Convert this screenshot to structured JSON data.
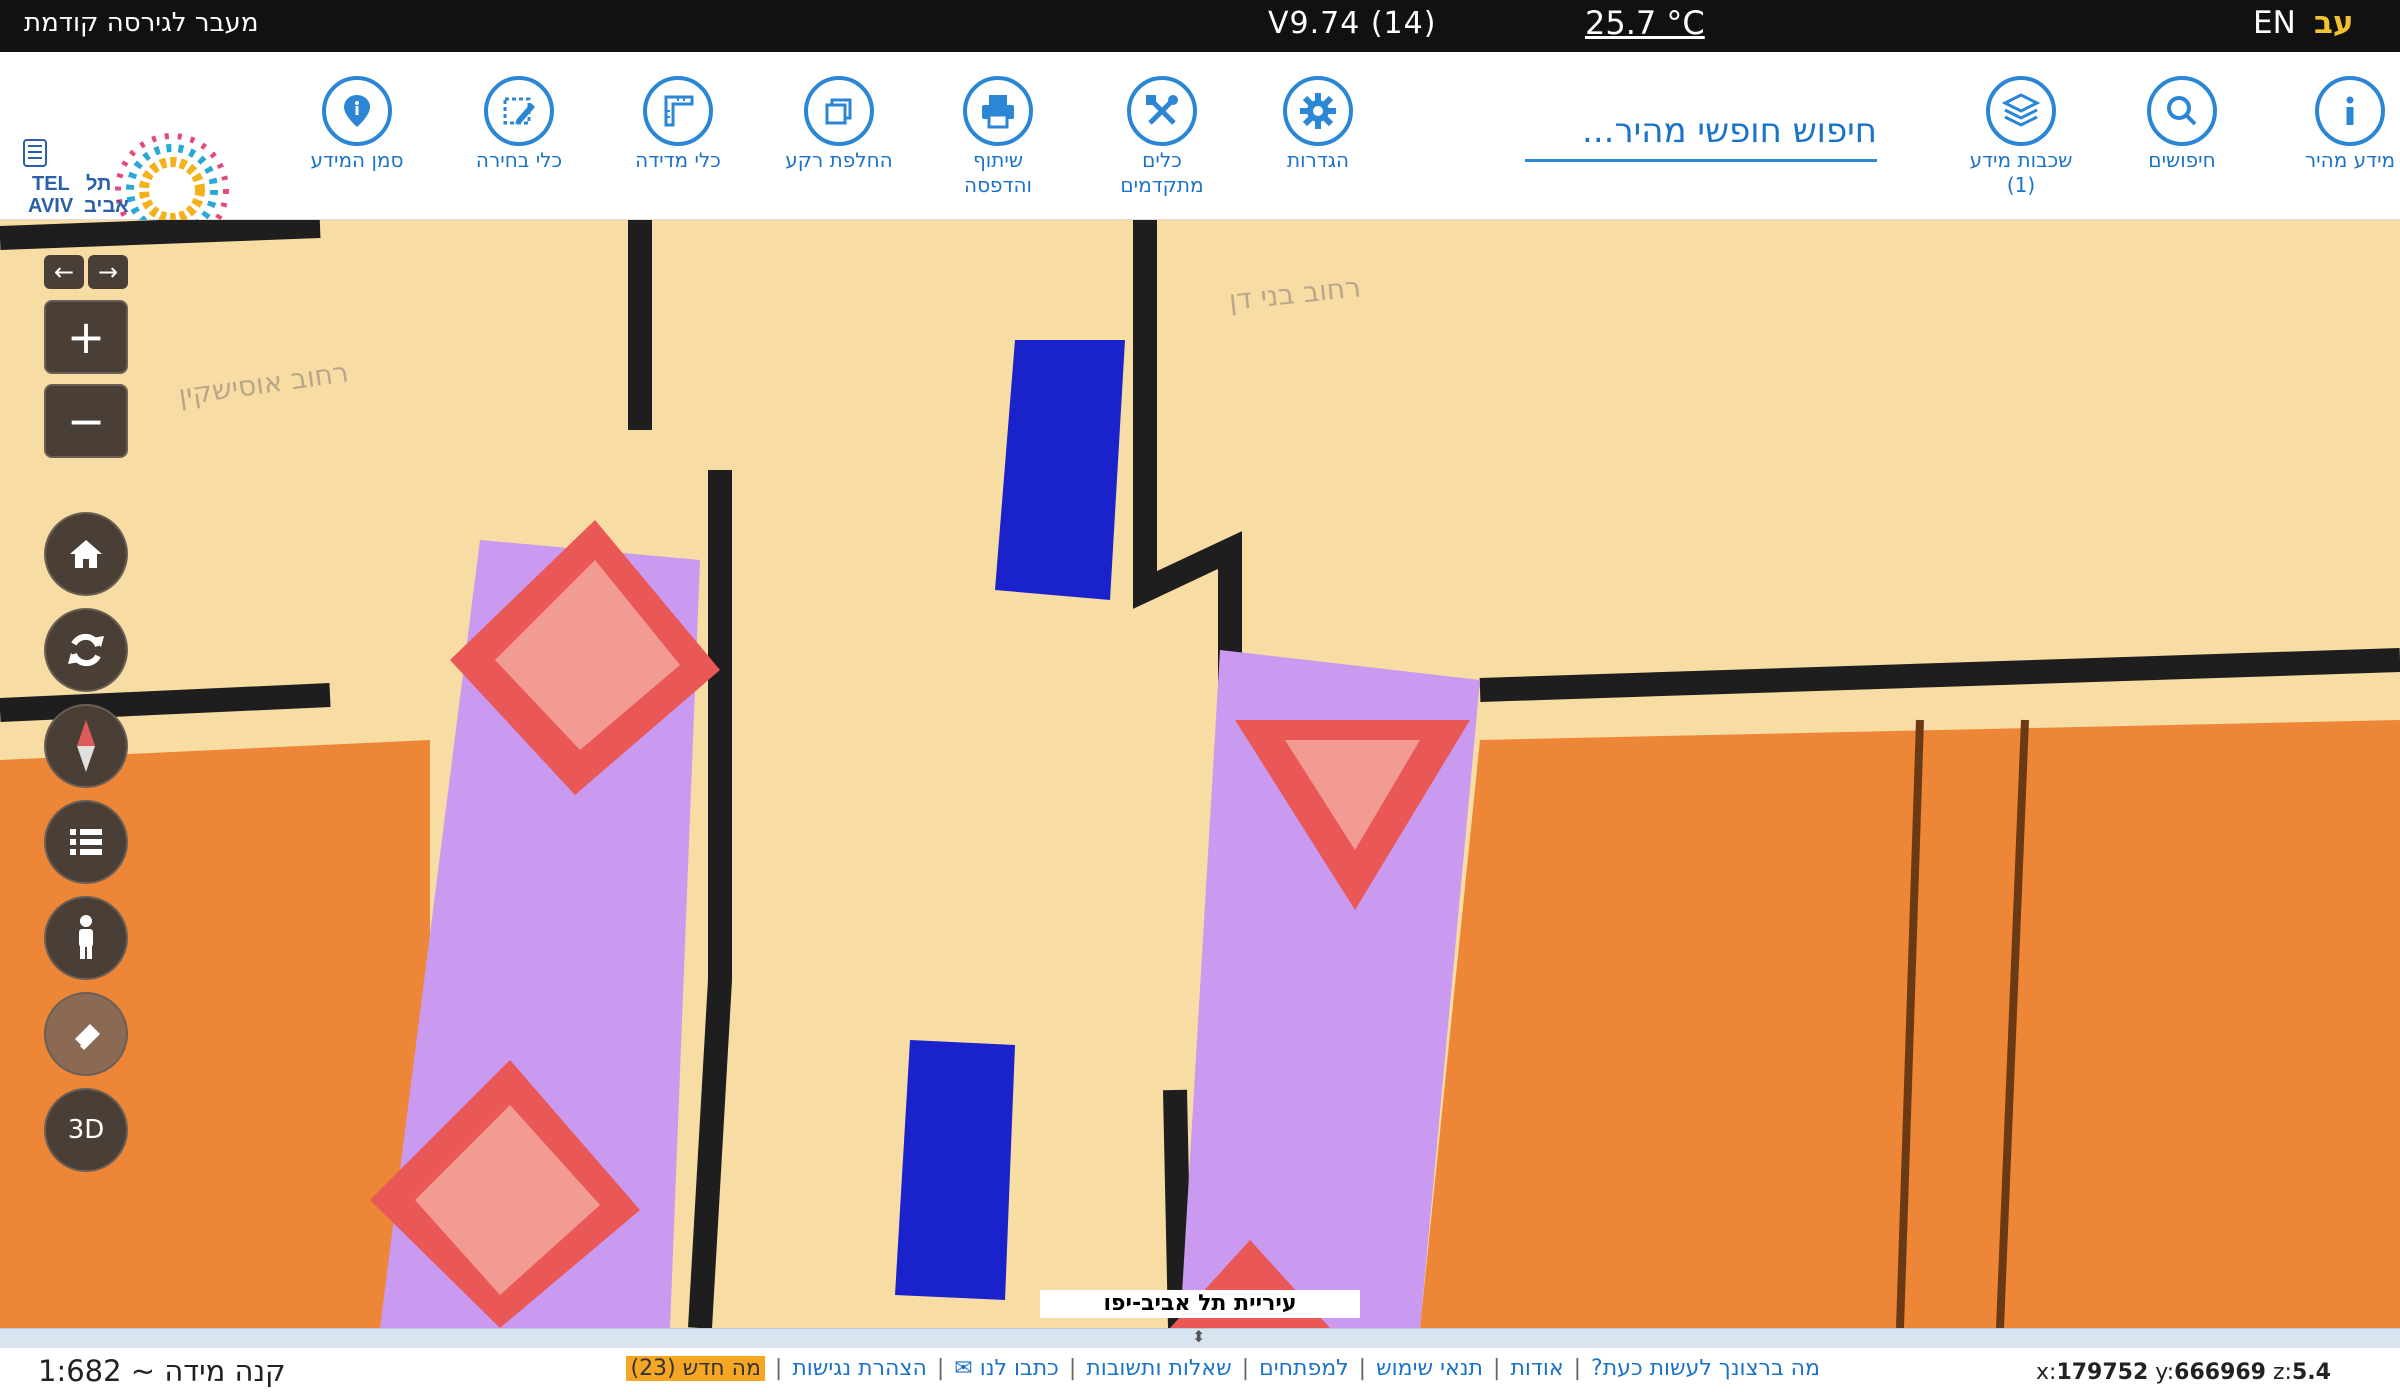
{
  "topbar": {
    "prev_version": "מעבר לגירסה קודמת",
    "version": "V9.74 (14)",
    "temperature": "25.7 °C",
    "lang_en": "EN",
    "lang_he": "עב"
  },
  "toolbar": {
    "tools": [
      {
        "label": "מידע מהיר",
        "label2": "",
        "icon": "info-icon"
      },
      {
        "label": "חיפושים",
        "label2": "",
        "icon": "search-icon"
      },
      {
        "label": "שכבות מידע",
        "label2": "(1)",
        "icon": "layers-icon"
      },
      {
        "label": "הגדרות",
        "label2": "",
        "icon": "gear-icon"
      },
      {
        "label": "כלים",
        "label2": "מתקדמים",
        "icon": "tools-icon"
      },
      {
        "label": "שיתוף",
        "label2": "והדפסה",
        "icon": "print-icon"
      },
      {
        "label": "החלפת רקע",
        "label2": "",
        "icon": "background-swap-icon"
      },
      {
        "label": "כלי מדידה",
        "label2": "",
        "icon": "ruler-icon"
      },
      {
        "label": "כלי בחירה",
        "label2": "",
        "icon": "select-edit-icon"
      },
      {
        "label": "סמן המידע",
        "label2": "",
        "icon": "map-pin-icon"
      }
    ],
    "search_placeholder": "חיפוש חופשי מהיר...",
    "logo_text": "TEL AVIV YAFO תל אביב יפו"
  },
  "map": {
    "controls": {
      "zoom_in": "+",
      "zoom_out": "−",
      "threed": "3D"
    },
    "labels": {
      "street1": "רחוב בני דן",
      "street2": "רחוב אוסישקין",
      "big_text": "בני דן"
    },
    "city_label": "עיריית תל אביב-יפו"
  },
  "bottombar": {
    "scale": "קנה מידה ~ 1:682",
    "links": [
      "מה ברצונך לעשות כעת?",
      "אודות",
      "תנאי שימוש",
      "למפתחים",
      "שאלות ותשובות",
      "כתבו לנו ✉",
      "הצהרת נגישות"
    ],
    "news": "מה חדש (23)",
    "coords": {
      "x_label": "x:",
      "x": "179752",
      "y_label": "y:",
      "y": "666969",
      "z_label": "z:",
      "z": "5.4"
    }
  },
  "colors": {
    "map_bg": "#f7dca3",
    "orange_area": "#ee8637",
    "purple_area": "#c99af0",
    "red_marker": "#ea5757",
    "blue_block": "#1a22cc",
    "accent_blue": "#1a73c9"
  }
}
